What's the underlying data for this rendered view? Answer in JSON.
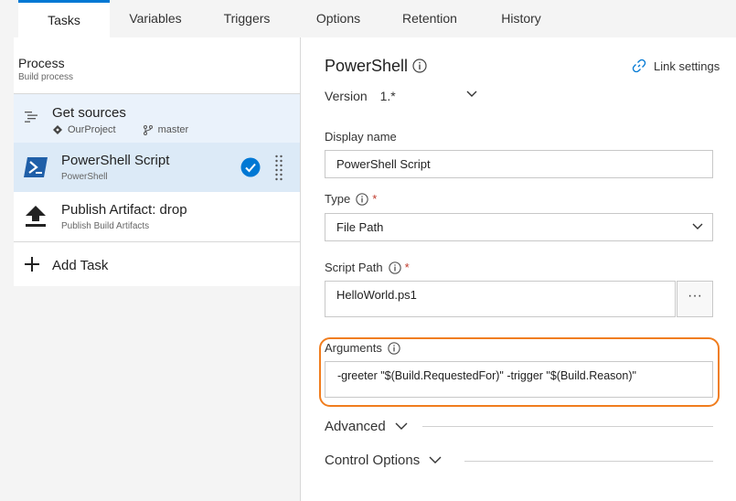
{
  "tabs": [
    {
      "label": "Tasks",
      "active": true
    },
    {
      "label": "Variables",
      "active": false
    },
    {
      "label": "Triggers",
      "active": false
    },
    {
      "label": "Options",
      "active": false
    },
    {
      "label": "Retention",
      "active": false
    },
    {
      "label": "History",
      "active": false
    }
  ],
  "process": {
    "title": "Process",
    "subtitle": "Build process"
  },
  "get_sources": {
    "title": "Get sources",
    "project": "OurProject",
    "branch": "master",
    "icon": "get-sources-icon",
    "project_icon": "git-repo-icon",
    "branch_icon": "branch-icon"
  },
  "tasks": [
    {
      "title": "PowerShell Script",
      "subtitle": "PowerShell",
      "icon": "powershell-icon",
      "selected": true
    },
    {
      "title": "Publish Artifact: drop",
      "subtitle": "Publish Build Artifacts",
      "icon": "upload-icon",
      "selected": false
    }
  ],
  "add_task": {
    "label": "Add Task",
    "icon": "plus-icon"
  },
  "detail": {
    "title": "PowerShell",
    "link_settings": "Link settings",
    "version_label": "Version",
    "version_value": "1.*",
    "display_name": {
      "label": "Display name",
      "value": "PowerShell Script"
    },
    "type": {
      "label": "Type",
      "required_mark": "*",
      "value": "File Path"
    },
    "script_path": {
      "label": "Script Path",
      "required_mark": "*",
      "value": "HelloWorld.ps1",
      "browse_label": "···"
    },
    "arguments": {
      "label": "Arguments",
      "value": "-greeter \"$(Build.RequestedFor)\" -trigger \"$(Build.Reason)\""
    },
    "advanced": "Advanced",
    "control_options": "Control Options"
  },
  "colors": {
    "accent": "#0078d4",
    "highlight": "#f07d1e",
    "required": "#c0392b",
    "powershell": "#1f5fa8"
  }
}
